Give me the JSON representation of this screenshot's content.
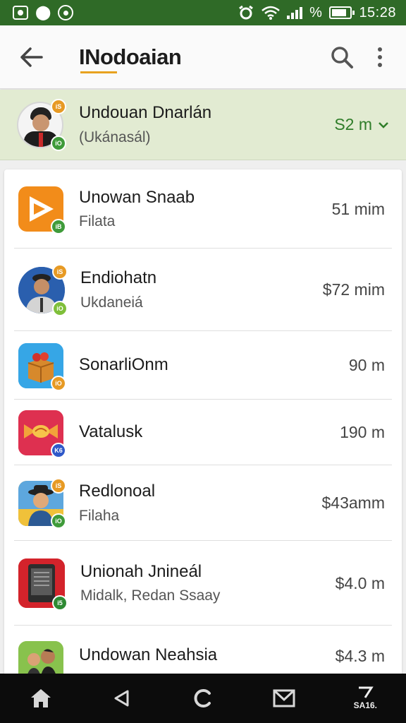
{
  "status_bar": {
    "time": "15:28",
    "battery_label": "%",
    "icons": [
      "image-icon",
      "notification-icon",
      "whatsapp-icon",
      "alarm-icon",
      "wifi-icon",
      "signal-icon",
      "battery-icon"
    ]
  },
  "app_bar": {
    "title": "INodoaian",
    "icons": [
      "back-arrow-icon",
      "search-icon",
      "more-vert-icon"
    ]
  },
  "highlighted": {
    "title": "Undouan Dnarlán",
    "subtitle": "(Ukánasál)",
    "meta": "S2 m",
    "meta_color": "#2f7d29"
  },
  "items": [
    {
      "title": "Unowan Snaab",
      "subtitle": "Filata",
      "meta": "51 mim",
      "icon": "play-icon"
    },
    {
      "title": "Endiohatn",
      "subtitle": "Ukdaneiá",
      "meta": "$72 mim",
      "icon": "avatar-man-icon"
    },
    {
      "title": "SonarliOnm",
      "subtitle": "",
      "meta": "90 m",
      "icon": "gift-box-icon"
    },
    {
      "title": "Vatalusk",
      "subtitle": "",
      "meta": "190 m",
      "icon": "candy-icon"
    },
    {
      "title": "Redlonoal",
      "subtitle": "Filaha",
      "meta": "$43amm",
      "icon": "avatar-hat-icon"
    },
    {
      "title": "Unionah Jnineál",
      "subtitle": "Midalk, Redan Ssaay",
      "meta": "$4.0 m",
      "icon": "phone-icon"
    },
    {
      "title": "Undowan Neahsia",
      "subtitle": "",
      "meta": "$4.3 m",
      "icon": "avatar-pair-icon"
    }
  ],
  "nav_bar": {
    "last_label": "SA16."
  },
  "colors": {
    "status_bar": "#2f6a27",
    "highlight": "#e2ebd2",
    "accent_orange": "#e8a21f",
    "badge_green": "#3f9b3a"
  }
}
